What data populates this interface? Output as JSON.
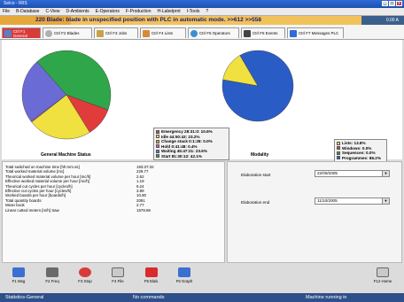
{
  "window": {
    "title": "Selco - IRIS",
    "buttons": [
      "_",
      "□",
      "x"
    ]
  },
  "menu": [
    "File",
    "B-Database",
    "C-View",
    "D-Ambients",
    "E-Operators",
    "F-Production",
    "H-Labelprnt",
    "I-Tools",
    "?"
  ],
  "alarm": {
    "message": "220 Blade: blade in unspecified position with PLC in automatic mode. >>612 >>558",
    "value": "0.00 A"
  },
  "tabs": [
    {
      "label": "Ctrl F1 General",
      "color": "#5a7fc4"
    },
    {
      "label": "Ctrl F2 Blades",
      "color": "#b0b0b0"
    },
    {
      "label": "Ctrl F3 Jobs",
      "color": "#c9a14a"
    },
    {
      "label": "Ctrl F4 Lists",
      "color": "#d68a3a"
    },
    {
      "label": "Ctrl F5 Operators",
      "color": "#3b8fd1"
    },
    {
      "label": "Ctrl F6 Events",
      "color": "#444444"
    },
    {
      "label": "Ctrl F7 Messages PLC",
      "color": "#2f6bd8"
    }
  ],
  "left_chart": {
    "title": "General Machine Status",
    "chart_data": {
      "type": "pie",
      "slices": [
        {
          "label": "Emergency 28:31:0: 10.6%",
          "value": 10.6,
          "color": "#e23b3b"
        },
        {
          "label": "Idle 44:50:43: 23.2%",
          "value": 23.2,
          "color": "#f0e040"
        },
        {
          "label": "Change stack 0:1:28: 0.0%",
          "value": 0.0,
          "color": "#f5a02a"
        },
        {
          "label": "Hold 0:41:48: 0.4%",
          "value": 0.4,
          "color": "#d95f9a"
        },
        {
          "label": "Waiting 45:47:21: 23.6%",
          "value": 23.6,
          "color": "#6b6bd6"
        },
        {
          "label": "Start 81:30:12: 42.1%",
          "value": 42.1,
          "color": "#2fa64a"
        }
      ]
    }
  },
  "right_chart": {
    "title": "Modality",
    "chart_data": {
      "type": "pie",
      "slices": [
        {
          "label": "Lists: 13.8%",
          "value": 13.8,
          "color": "#f0e040"
        },
        {
          "label": "Windows: 0.0%",
          "value": 0.0,
          "color": "#e23b3b"
        },
        {
          "label": "Sequences: 0.0%",
          "value": 0.0,
          "color": "#2fa64a"
        },
        {
          "label": "Programmes: 86.2%",
          "value": 86.2,
          "color": "#2a5cc6"
        }
      ]
    }
  },
  "stats": [
    {
      "k": "Total switched on machine time [hh:mm.ss]",
      "v": "193:37:32"
    },
    {
      "k": "Total worked material volume [mc]",
      "v": "229.77"
    },
    {
      "k": "Theorical worked material volume per hour [mc/h]",
      "v": "2.62"
    },
    {
      "k": "Effective worked material volume per hour [mc/h]",
      "v": "1.19"
    },
    {
      "k": "Theorical cut cycles per hour [cycles/h]",
      "v": "9.24"
    },
    {
      "k": "Effective cut cycles per hour [cycles/h]",
      "v": "3.89"
    },
    {
      "k": "Worked boards per hour [boards/h]",
      "v": "10.80"
    },
    {
      "k": "Total quantity boards",
      "v": "2091"
    },
    {
      "k": "Mean book",
      "v": "2.77"
    },
    {
      "k": "Linear cutted meters [m/h] Saw",
      "v": "1578.69"
    }
  ],
  "elaboration": {
    "start_label": "Elaboration start",
    "start_value": "22/09/2005",
    "end_label": "Elaboration end",
    "end_value": "11/10/2005"
  },
  "fkeys": [
    {
      "label": "F1 Msg",
      "color": "#3b6fd1"
    },
    {
      "label": "F2 Freq",
      "color": "#6a6a6a"
    },
    {
      "label": "F3 Stop",
      "color": "#d93b3b"
    },
    {
      "label": "F4 File",
      "color": "#c9c9c9"
    },
    {
      "label": "F5 Elab.",
      "color": "#d92b2b"
    },
    {
      "label": "F6 Graph",
      "color": "#3b6fd1"
    },
    {
      "label": "F12 Home",
      "color": "#c9c9c9"
    }
  ],
  "status": {
    "left": "Statistics-General",
    "middle": "No commands",
    "right": "Machine running in"
  }
}
